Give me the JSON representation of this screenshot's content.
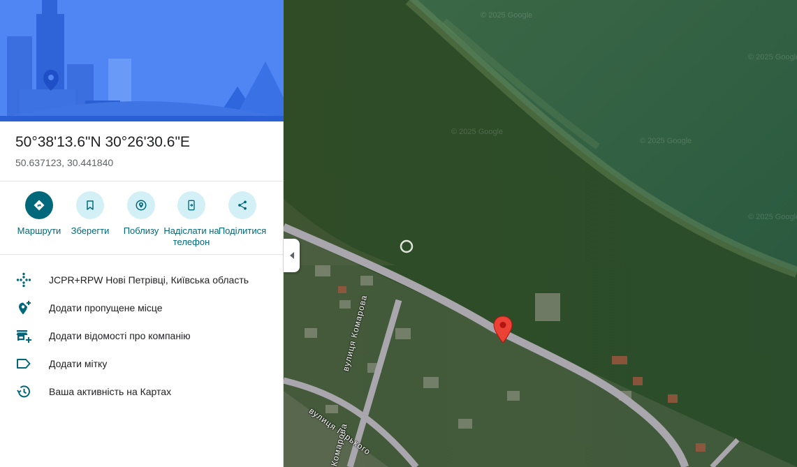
{
  "place": {
    "title": "50°38'13.6\"N 30°26'30.6\"E",
    "decimal_coords": "50.637123, 30.441840"
  },
  "actions": [
    {
      "label": "Маршрути",
      "icon": "directions-icon"
    },
    {
      "label": "Зберегти",
      "icon": "bookmark-icon"
    },
    {
      "label": "Поблизу",
      "icon": "nearby-icon"
    },
    {
      "label": "Надіслати на телефон",
      "icon": "send-to-phone-icon"
    },
    {
      "label": "Поділитися",
      "icon": "share-icon"
    }
  ],
  "details": [
    {
      "text": "JCPR+RPW Нові Петрівці, Київська область",
      "icon": "plus-code-icon"
    },
    {
      "text": "Додати пропущене місце",
      "icon": "add-place-icon"
    },
    {
      "text": "Додати відомості про компанію",
      "icon": "add-business-icon"
    },
    {
      "text": "Додати мітку",
      "icon": "label-icon"
    },
    {
      "text": "Ваша активність на Картах",
      "icon": "history-icon"
    }
  ],
  "map": {
    "watermark": "© 2025 Google",
    "streets": [
      "вулиця Комарова",
      "вулиця Горького",
      "Комарова"
    ]
  },
  "colors": {
    "accent": "#00687a",
    "accent_light": "#d3f0f6",
    "pin": "#ea4335",
    "hero_bg": "#4f86f4"
  }
}
